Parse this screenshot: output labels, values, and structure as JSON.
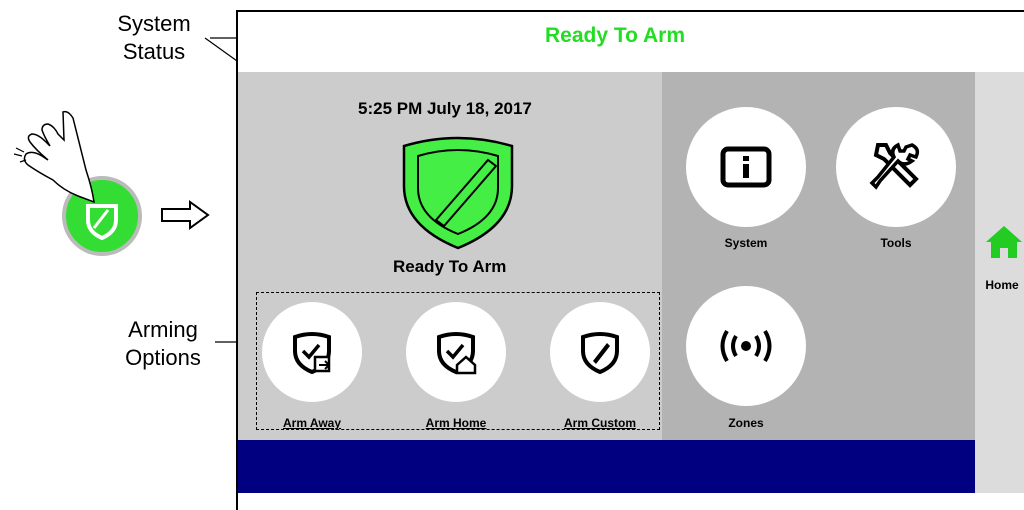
{
  "annotations": {
    "system_status": "System\nStatus",
    "arming_options": "Arming\nOptions"
  },
  "status_bar": {
    "text": "Ready To Arm",
    "color": "#22dd22"
  },
  "main": {
    "datetime": "5:25 PM July 18, 2017",
    "status_label": "Ready To Arm",
    "shield_color": "#44ee44"
  },
  "arming": {
    "away_label": "Arm Away",
    "home_label": "Arm Home",
    "custom_label": "Arm Custom"
  },
  "menu": {
    "system_label": "System",
    "tools_label": "Tools",
    "zones_label": "Zones"
  },
  "side": {
    "home_label": "Home"
  }
}
